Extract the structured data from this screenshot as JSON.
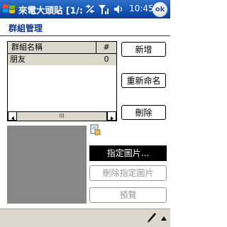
{
  "titlebar": {
    "title": "來電大頭貼 [1/:",
    "clock": "10:45",
    "ok_label": "ok",
    "icons": [
      "windows-start-icon",
      "connectivity-icon",
      "signal-icon",
      "volume-icon"
    ]
  },
  "page": {
    "title": "群組管理"
  },
  "group_list": {
    "columns": [
      "群組名稱",
      "#"
    ],
    "rows": [
      {
        "name": "朋友",
        "count": "0"
      }
    ],
    "scroll_thumb_glyph": "III"
  },
  "buttons": {
    "new": "新增",
    "rename": "重新命名",
    "delete": "刪除",
    "assign_photo": "指定圖片...",
    "remove_photo": "刪除指定圖片",
    "preview": "預覽"
  },
  "colors": {
    "titlebar": "#1554b4",
    "header_bg": "#dcd8cc",
    "photo_bg": "#878787",
    "disabled_text": "#999999"
  }
}
